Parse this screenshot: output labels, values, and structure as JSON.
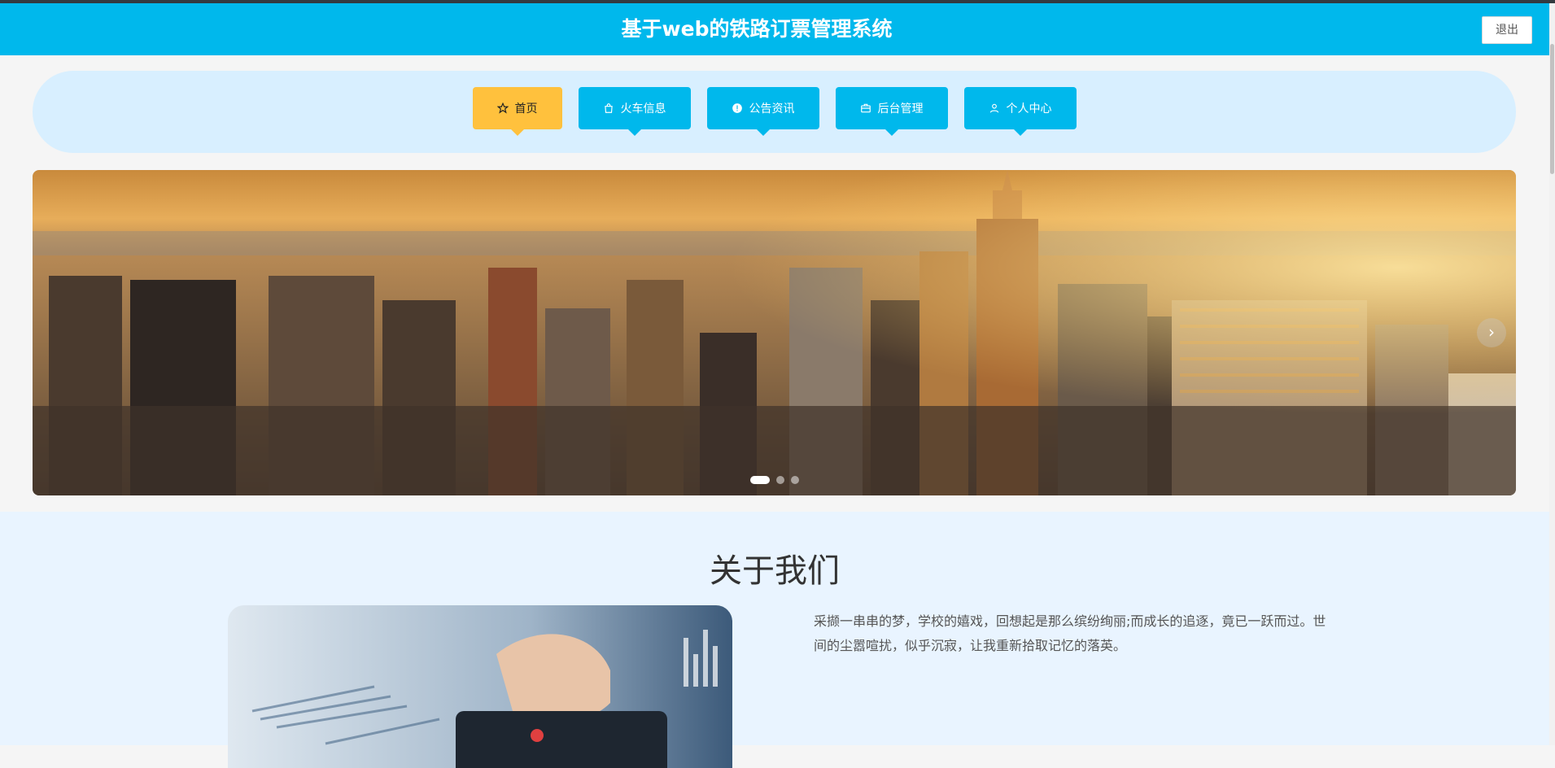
{
  "header": {
    "title": "基于web的铁路订票管理系统",
    "logout_label": "退出"
  },
  "nav": {
    "items": [
      {
        "label": "首页",
        "icon": "star-icon",
        "active": true
      },
      {
        "label": "火车信息",
        "icon": "shopping-bag-icon"
      },
      {
        "label": "公告资讯",
        "icon": "info-circle-icon"
      },
      {
        "label": "后台管理",
        "icon": "briefcase-icon"
      },
      {
        "label": "个人中心",
        "icon": "user-icon"
      }
    ]
  },
  "banner": {
    "image": "city-skyline-sunset",
    "slides": 3,
    "active_slide": 1,
    "next_icon": "chevron-right-icon"
  },
  "about": {
    "heading": "关于我们",
    "image": "finance-tablet-hand",
    "text": "采撷一串串的梦，学校的嬉戏，回想起是那么缤纷绚丽;而成长的追逐，竟已一跃而过。世间的尘嚣喧扰，似乎沉寂，让我重新拾取记忆的落英。"
  },
  "colors": {
    "header_bg": "#00b8ec",
    "nav_bg": "#d8efff",
    "nav_item_bg": "#00b8ec",
    "nav_active_bg": "#ffc13d",
    "about_bg": "#e9f4ff"
  }
}
